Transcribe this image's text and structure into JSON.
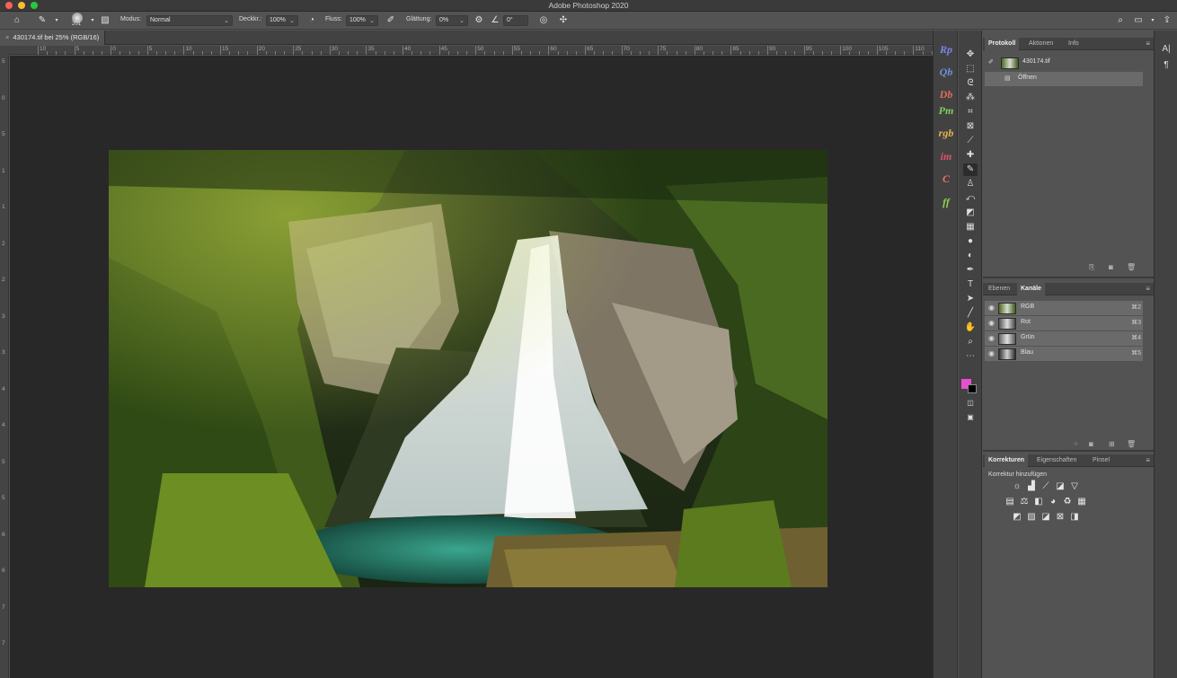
{
  "window": {
    "title": "Adobe Photoshop 2020"
  },
  "options_bar": {
    "brush_size": "201",
    "mode_label": "Modus:",
    "mode_value": "Normal",
    "opacity_label": "Deckkr.:",
    "opacity_value": "100%",
    "flow_label": "Fluss:",
    "flow_value": "100%",
    "smoothing_label": "Glättung:",
    "smoothing_value": "0%",
    "angle_value": "0°"
  },
  "document": {
    "tab_title": "430174.tif bei 25% (RGB/16)",
    "close_glyph": "×"
  },
  "rulers": {
    "h_labels": [
      "10",
      "5",
      "0",
      "5",
      "10",
      "15",
      "20",
      "25",
      "30",
      "35",
      "40",
      "45",
      "50",
      "55",
      "60",
      "65",
      "70",
      "75",
      "80",
      "85",
      "90",
      "95",
      "100",
      "105",
      "110"
    ],
    "v_labels": [
      "5",
      "0",
      "5",
      "1",
      "1",
      "2",
      "2",
      "3",
      "3",
      "4",
      "4",
      "5",
      "5",
      "6",
      "6",
      "7",
      "7"
    ]
  },
  "plugins": [
    {
      "label": "Rp",
      "color": "#7b86e8"
    },
    {
      "label": "Qb",
      "color": "#6f8fe0"
    },
    {
      "label": "Db",
      "color": "#e56a5a"
    },
    {
      "label": "Pm",
      "color": "#7fcf5f"
    },
    {
      "label": "rgb",
      "color": "#e0b54a"
    },
    {
      "label": "im",
      "color": "#e0506a"
    },
    {
      "label": "C",
      "color": "#f07060"
    },
    {
      "label": "ff",
      "color": "#8ed04a"
    }
  ],
  "protokoll_panel": {
    "tabs": [
      "Protokoll",
      "Aktionen",
      "Info"
    ],
    "snapshot_name": "430174.tif",
    "history_items": [
      "Öffnen"
    ]
  },
  "channels_panel": {
    "tabs": [
      "Ebenen",
      "Kanäle"
    ],
    "channels": [
      {
        "name": "RGB",
        "shortcut": "⌘2"
      },
      {
        "name": "Rot",
        "shortcut": "⌘3"
      },
      {
        "name": "Grün",
        "shortcut": "⌘4"
      },
      {
        "name": "Blau",
        "shortcut": "⌘5"
      }
    ]
  },
  "adjustments_panel": {
    "tabs": [
      "Korrekturen",
      "Eigenschaften",
      "Pinsel"
    ],
    "subtitle": "Korrektur hinzufügen"
  },
  "colors": {
    "foreground": "#e84fd0",
    "background": "#000000",
    "traffic_red": "#ff5f57",
    "traffic_yellow": "#febc2e",
    "traffic_green": "#28c840"
  }
}
